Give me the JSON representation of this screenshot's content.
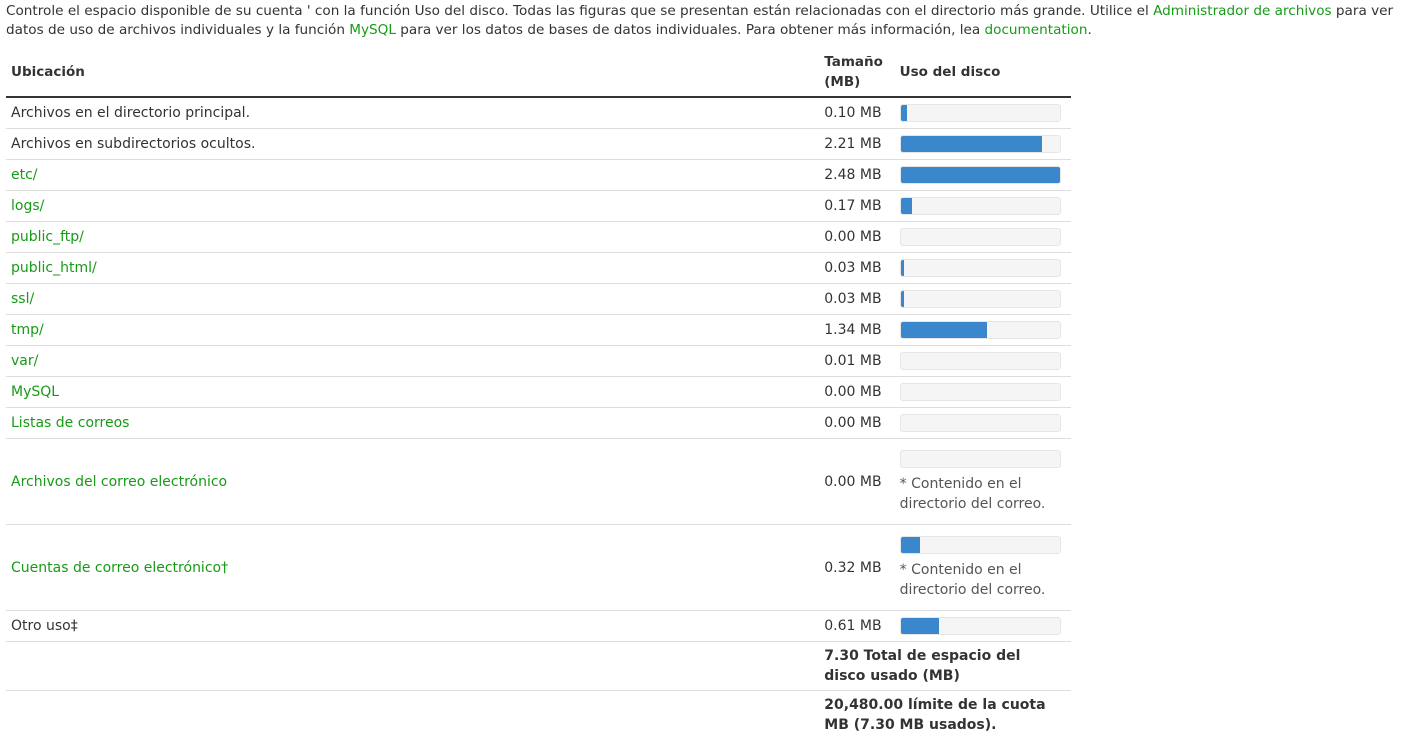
{
  "intro": {
    "part1": "Controle el espacio disponible de su cuenta ' con la función Uso del disco. Todas las figuras que se presentan están relacionadas con el directorio más grande. Utilice el ",
    "link_file_manager": "Administrador de archivos",
    "part2": " para ver datos de uso de archivos individuales y la función ",
    "link_mysql": "MySQL",
    "part3": " para ver los datos de bases de datos individuales. Para obtener más información, lea ",
    "link_docs": "documentation",
    "part4": "."
  },
  "table": {
    "headers": {
      "location": "Ubicación",
      "size": "Tamaño (MB)",
      "usage": "Uso del disco"
    },
    "rows": [
      {
        "label": "Archivos en el directorio principal.",
        "link": false,
        "size": "0.10 MB",
        "percent": 4
      },
      {
        "label": "Archivos en subdirectorios ocultos.",
        "link": false,
        "size": "2.21 MB",
        "percent": 89
      },
      {
        "label": "etc/",
        "link": true,
        "size": "2.48 MB",
        "percent": 100
      },
      {
        "label": "logs/",
        "link": true,
        "size": "0.17 MB",
        "percent": 7
      },
      {
        "label": "public_ftp/",
        "link": true,
        "size": "0.00 MB",
        "percent": 0
      },
      {
        "label": "public_html/",
        "link": true,
        "size": "0.03 MB",
        "percent": 2
      },
      {
        "label": "ssl/",
        "link": true,
        "size": "0.03 MB",
        "percent": 2
      },
      {
        "label": "tmp/",
        "link": true,
        "size": "1.34 MB",
        "percent": 54
      },
      {
        "label": "var/",
        "link": true,
        "size": "0.01 MB",
        "percent": 0
      },
      {
        "label": "MySQL",
        "link": true,
        "size": "0.00 MB",
        "percent": 0
      },
      {
        "label": "Listas de correos",
        "link": true,
        "size": "0.00 MB",
        "percent": 0
      },
      {
        "label": "Archivos del correo electrónico",
        "link": true,
        "size": "0.00 MB",
        "percent": 0,
        "note": "* Contenido en el directorio del correo."
      },
      {
        "label": "Cuentas de correo electrónico†",
        "link": true,
        "size": "0.32 MB",
        "percent": 12,
        "note": "* Contenido en el directorio del correo."
      },
      {
        "label": "Otro uso‡",
        "link": false,
        "size": "0.61 MB",
        "percent": 24
      }
    ],
    "total_used": "7.30 Total de espacio del disco usado (MB)",
    "quota": "20,480.00 límite de la cuota MB (7.30 MB usados)."
  },
  "colors": {
    "link": "#179b17",
    "bar_fill": "#3b87cc",
    "bar_bg": "#f5f5f5"
  }
}
